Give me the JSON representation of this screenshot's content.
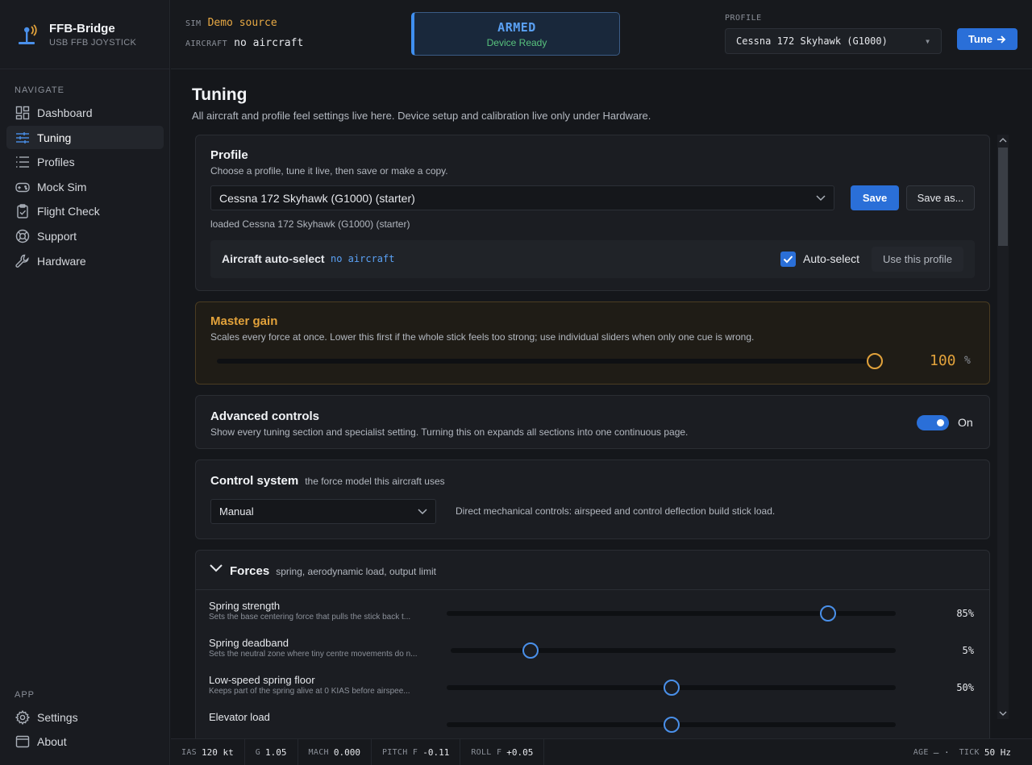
{
  "brand": {
    "title": "FFB-Bridge",
    "subtitle": "USB FFB JOYSTICK"
  },
  "nav": {
    "heading": "NAVIGATE",
    "items": [
      {
        "label": "Dashboard",
        "icon": "dashboard-icon",
        "active": false
      },
      {
        "label": "Tuning",
        "icon": "sliders-icon",
        "active": true
      },
      {
        "label": "Profiles",
        "icon": "list-icon",
        "active": false
      },
      {
        "label": "Mock Sim",
        "icon": "gamepad-icon",
        "active": false
      },
      {
        "label": "Flight Check",
        "icon": "clipboard-check-icon",
        "active": false
      },
      {
        "label": "Support",
        "icon": "lifebuoy-icon",
        "active": false
      },
      {
        "label": "Hardware",
        "icon": "wrench-icon",
        "active": false
      }
    ],
    "app_heading": "APP",
    "app_items": [
      {
        "label": "Settings",
        "icon": "gear-icon"
      },
      {
        "label": "About",
        "icon": "window-icon"
      }
    ]
  },
  "topbar": {
    "sim_key": "SIM",
    "sim_value": "Demo source",
    "aircraft_key": "AIRCRAFT",
    "aircraft_value": "no aircraft",
    "status_title": "ARMED",
    "status_sub": "Device Ready",
    "profile_label": "PROFILE",
    "profile_value": "Cessna 172 Skyhawk (G1000)",
    "tune_label": "Tune"
  },
  "page": {
    "title": "Tuning",
    "subtitle": "All aircraft and profile feel settings live here. Device setup and calibration live only under Hardware."
  },
  "profile_card": {
    "title": "Profile",
    "desc": "Choose a profile, tune it live, then save or make a copy.",
    "selected": "Cessna 172 Skyhawk (G1000) (starter)",
    "save_label": "Save",
    "save_as_label": "Save as...",
    "loaded_text": "loaded Cessna 172 Skyhawk (G1000) (starter)",
    "autoselect_title": "Aircraft auto-select",
    "autoselect_aircraft": "no aircraft",
    "autoselect_checkbox_label": "Auto-select",
    "autoselect_checked": true,
    "use_profile_label": "Use this profile"
  },
  "master_gain": {
    "title": "Master gain",
    "desc": "Scales every force at once. Lower this first if the whole stick feels too strong; use individual sliders when only one cue is wrong.",
    "value": "100",
    "unit": "%",
    "fraction": 1.0
  },
  "advanced": {
    "title": "Advanced controls",
    "desc": "Show every tuning section and specialist setting. Turning this on expands all sections into one continuous page.",
    "state_label": "On",
    "enabled": true
  },
  "control_system": {
    "title": "Control system",
    "hint": "the force model this aircraft uses",
    "selected": "Manual",
    "description": "Direct mechanical controls: airspeed and control deflection build stick load."
  },
  "forces": {
    "title": "Forces",
    "hint": "spring, aerodynamic load, output limit",
    "sliders": [
      {
        "name": "Spring strength",
        "desc": "Sets the base centering force that pulls the stick back t...",
        "value": "85%",
        "fraction": 0.85
      },
      {
        "name": "Spring deadband",
        "desc": "Sets the neutral zone where tiny centre movements do n...",
        "value": "5%",
        "fraction": 0.18
      },
      {
        "name": "Low-speed spring floor",
        "desc": "Keeps part of the spring alive at 0 KIAS before airspee...",
        "value": "50%",
        "fraction": 0.5
      },
      {
        "name": "Elevator load",
        "desc": "",
        "value": "",
        "fraction": 0.5
      }
    ]
  },
  "statusbar": {
    "ias_key": "IAS",
    "ias_val": "120 kt",
    "g_key": "G",
    "g_val": "1.05",
    "mach_key": "MACH",
    "mach_val": "0.000",
    "pitch_key": "PITCH F",
    "pitch_val": "-0.11",
    "roll_key": "ROLL F",
    "roll_val": "+0.05",
    "age_key": "AGE",
    "age_val": "— ·",
    "tick_key": "TICK",
    "tick_val": "50 Hz"
  },
  "colors": {
    "accent": "#2a6fd8",
    "armed_text": "#5aa1f5",
    "ready_text": "#58c27d",
    "master_gain_accent": "#e2a23b",
    "sim_value": "#e8a944",
    "mono_link": "#5aa1f5"
  }
}
